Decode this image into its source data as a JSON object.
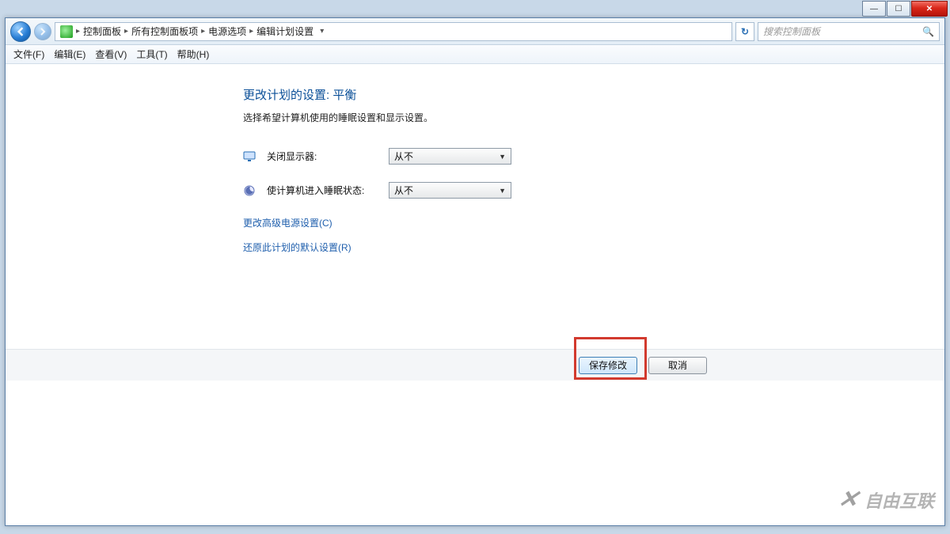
{
  "chrome": {
    "min": "—",
    "max": "☐",
    "close": "✕"
  },
  "breadcrumbs": [
    "控制面板",
    "所有控制面板项",
    "电源选项",
    "编辑计划设置"
  ],
  "refresh_label": "↻",
  "search_placeholder": "搜索控制面板",
  "menus": [
    "文件(F)",
    "编辑(E)",
    "查看(V)",
    "工具(T)",
    "帮助(H)"
  ],
  "page": {
    "title": "更改计划的设置: 平衡",
    "subtitle": "选择希望计算机使用的睡眠设置和显示设置。"
  },
  "settings": {
    "display_off": {
      "label": "关闭显示器:",
      "value": "从不"
    },
    "sleep": {
      "label": "使计算机进入睡眠状态:",
      "value": "从不"
    }
  },
  "links": {
    "advanced": "更改高级电源设置(C)",
    "restore": "还原此计划的默认设置(R)"
  },
  "buttons": {
    "save": "保存修改",
    "cancel": "取消"
  },
  "watermark": "自由互联"
}
